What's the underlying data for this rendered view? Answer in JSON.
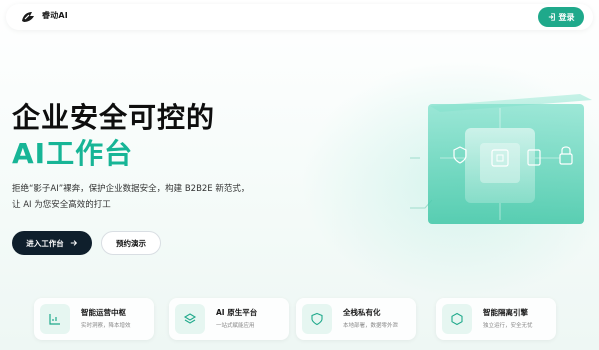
{
  "header": {
    "brand": "睿动AI",
    "login_label": "登录"
  },
  "hero": {
    "title_line1": "企业安全可控的",
    "title_line2": "AI工作台",
    "description_line1": "拒绝“影子AI”裸奔，保护企业数据安全，构建 B2B2E 新范式，",
    "description_line2": "让 AI 为您安全高效的打工",
    "primary_button": "进入工作台",
    "secondary_button": "预约演示"
  },
  "features": [
    {
      "title": "智能运营中枢",
      "subtitle": "实时洞察，降本增效",
      "icon": "chart-icon"
    },
    {
      "title": "AI 原生平台",
      "subtitle": "一站式赋能应用",
      "icon": "layers-icon"
    },
    {
      "title": "全栈私有化",
      "subtitle": "本地部署，数据零外泄",
      "icon": "shield-icon"
    },
    {
      "title": "智能隔离引擎",
      "subtitle": "独立运行，安全无忧",
      "icon": "hexagon-icon"
    }
  ],
  "colors": {
    "accent": "#17b596",
    "login_bg": "#1fa98b",
    "primary_btn_bg": "#0f1f2c"
  }
}
